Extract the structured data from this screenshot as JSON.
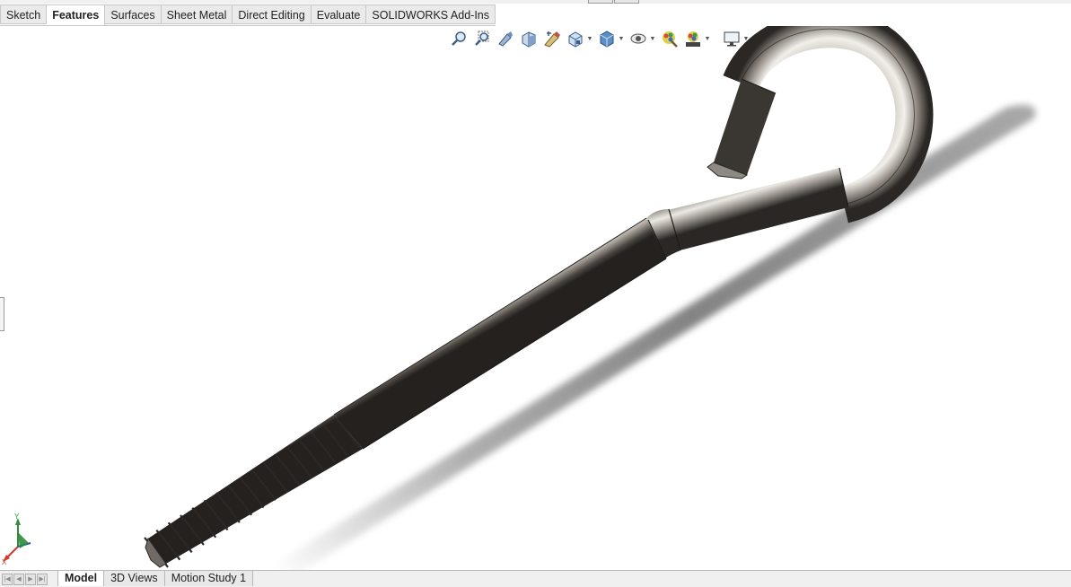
{
  "command_manager": {
    "tabs": [
      {
        "label": "Sketch",
        "active": false
      },
      {
        "label": "Features",
        "active": true
      },
      {
        "label": "Surfaces",
        "active": false
      },
      {
        "label": "Sheet Metal",
        "active": false
      },
      {
        "label": "Direct Editing",
        "active": false
      },
      {
        "label": "Evaluate",
        "active": false
      },
      {
        "label": "SOLIDWORKS Add-Ins",
        "active": false
      }
    ]
  },
  "heads_up_toolbar": {
    "icons": [
      "zoom-to-fit-icon",
      "zoom-to-area-icon",
      "previous-view-icon",
      "section-view-icon",
      "dynamic-annotation-icon",
      "view-orientation-icon",
      "display-style-icon",
      "hide-show-items-icon",
      "edit-appearance-icon",
      "apply-scene-icon",
      "view-settings-icon"
    ]
  },
  "triad": {
    "x_label": "X",
    "y_label": "Y",
    "z_label": "Z"
  },
  "bottom_tabs": {
    "tabs": [
      {
        "label": "Model",
        "active": true
      },
      {
        "label": "3D Views",
        "active": false
      },
      {
        "label": "Motion Study 1",
        "active": false
      }
    ]
  },
  "colors": {
    "tab_bg": "#eaeaea",
    "tab_active_bg": "#ffffff",
    "border": "#c8c8c8",
    "metal_dark": "#4a4540",
    "metal_light": "#d6d2cc"
  }
}
